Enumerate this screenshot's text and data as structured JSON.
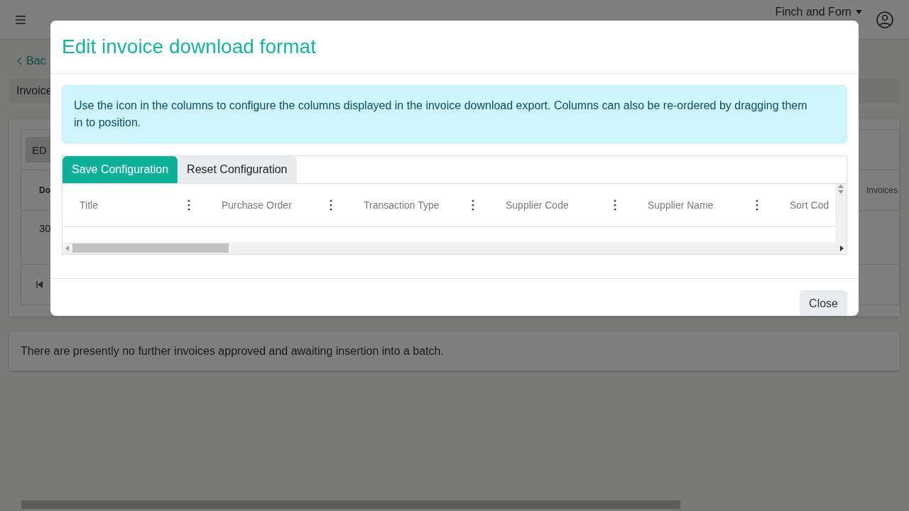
{
  "header": {
    "account": "Finch and Forn"
  },
  "page": {
    "back_link": "Bac",
    "section_title": "Invoice",
    "edit_button": "ED",
    "table_header": "Do",
    "column_fragment": "Invoices",
    "table_cell": "30",
    "notice": "There are presently no further invoices approved and awaiting insertion into a batch."
  },
  "modal": {
    "title": "Edit invoice download format",
    "info": "Use the icon in the columns to configure the columns displayed in the invoice download export. Columns can also be re-ordered by dragging them in to position.",
    "buttons": [
      {
        "label": "Save Configuration",
        "kind": "primary"
      },
      {
        "label": "Reset Configuration",
        "kind": "secondary"
      }
    ],
    "columns": [
      "Title",
      "Purchase Order",
      "Transaction Type",
      "Supplier Code",
      "Supplier Name",
      "Sort Cod"
    ],
    "close": "Close"
  }
}
